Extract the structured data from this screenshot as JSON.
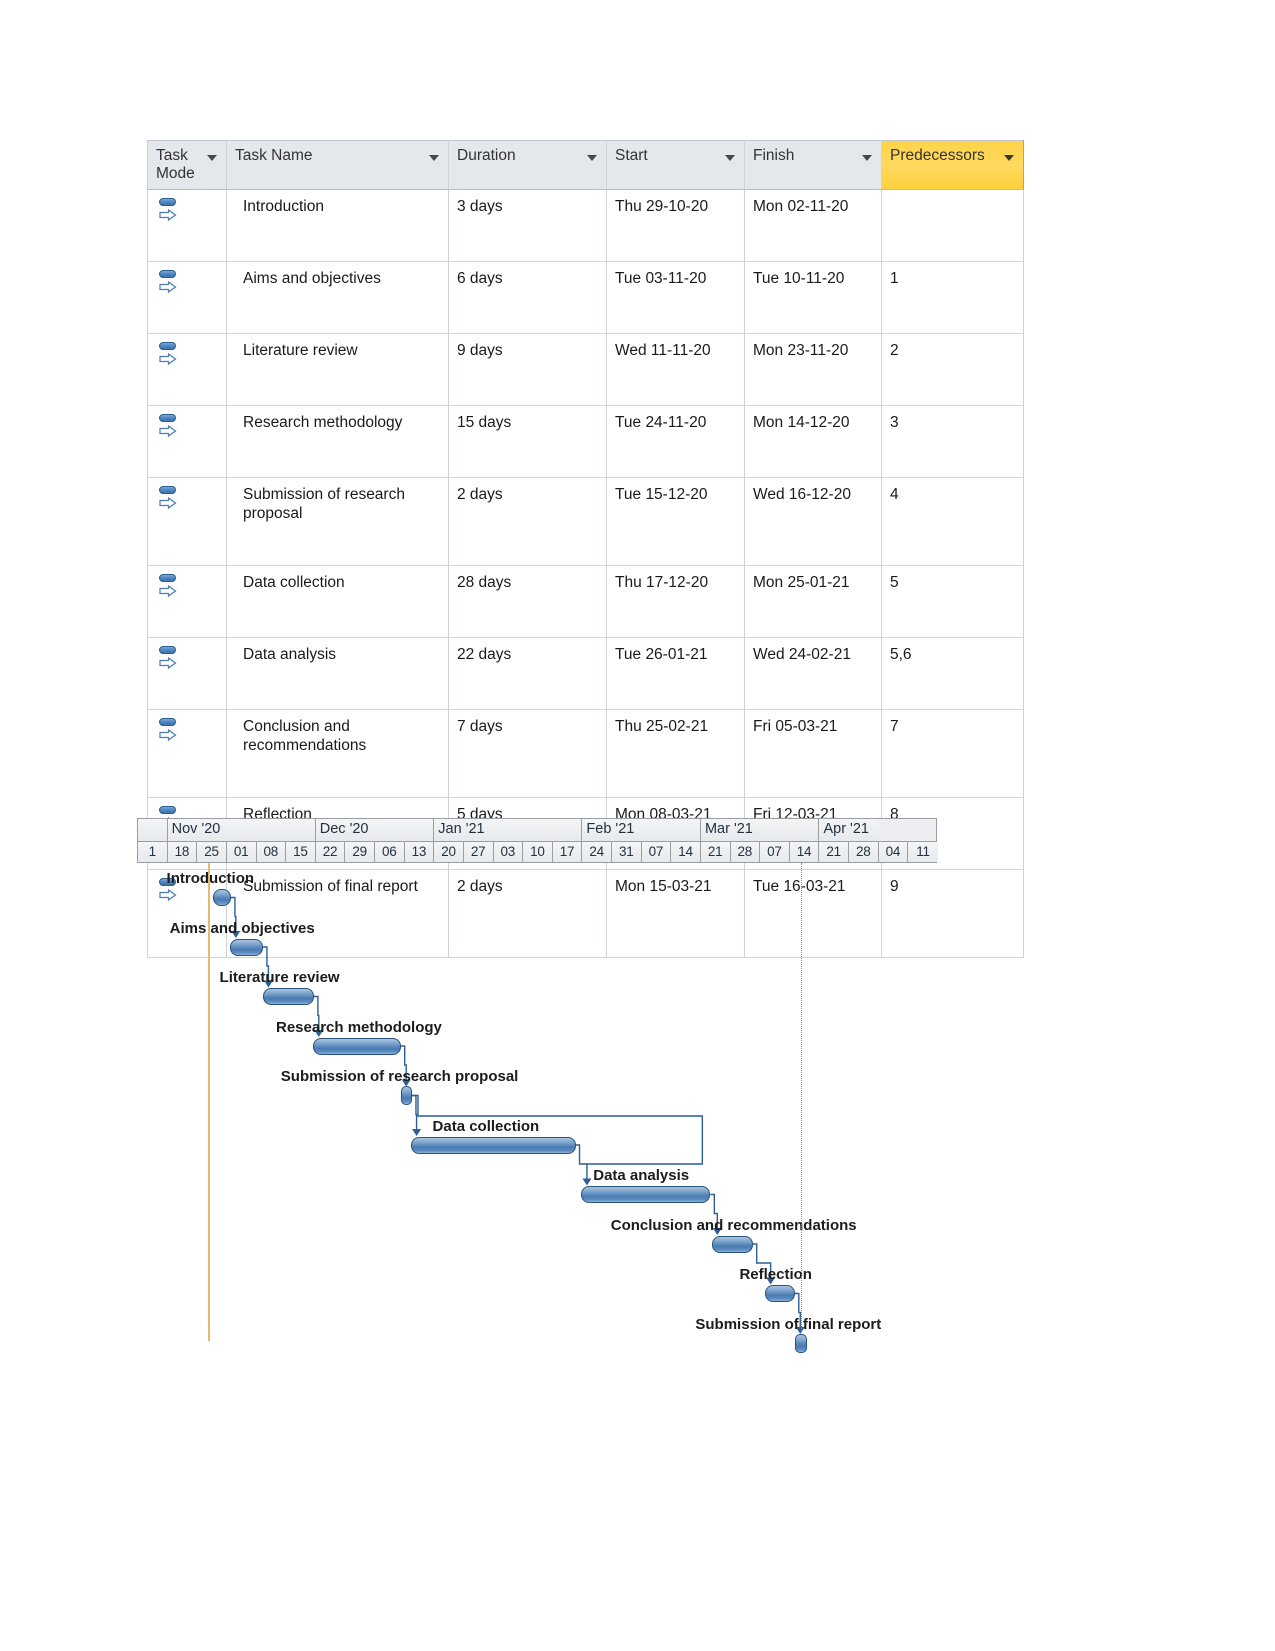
{
  "sheet": {
    "columns": [
      {
        "key": "task_mode",
        "label": "Task Mode",
        "highlight": false
      },
      {
        "key": "task_name",
        "label": "Task Name",
        "highlight": false
      },
      {
        "key": "duration",
        "label": "Duration",
        "highlight": false
      },
      {
        "key": "start",
        "label": "Start",
        "highlight": false
      },
      {
        "key": "finish",
        "label": "Finish",
        "highlight": false
      },
      {
        "key": "predecessors",
        "label": "Predecessors",
        "highlight": true
      }
    ],
    "filter_icon": "filter-dropdown-arrow-icon",
    "task_mode_icon": "auto-scheduled-task-icon",
    "rows": [
      {
        "task_name": "Introduction",
        "duration": "3 days",
        "start": "Thu 29-10-20",
        "finish": "Mon 02-11-20",
        "predecessors": ""
      },
      {
        "task_name": "Aims and objectives",
        "duration": "6 days",
        "start": "Tue 03-11-20",
        "finish": "Tue 10-11-20",
        "predecessors": "1"
      },
      {
        "task_name": "Literature review",
        "duration": "9 days",
        "start": "Wed 11-11-20",
        "finish": "Mon 23-11-20",
        "predecessors": "2"
      },
      {
        "task_name": "Research methodology",
        "duration": "15 days",
        "start": "Tue 24-11-20",
        "finish": "Mon 14-12-20",
        "predecessors": "3"
      },
      {
        "task_name": "Submission of research proposal",
        "duration": "2 days",
        "start": "Tue 15-12-20",
        "finish": "Wed 16-12-20",
        "predecessors": "4"
      },
      {
        "task_name": "Data collection",
        "duration": "28 days",
        "start": "Thu 17-12-20",
        "finish": "Mon 25-01-21",
        "predecessors": "5"
      },
      {
        "task_name": "Data analysis",
        "duration": "22 days",
        "start": "Tue 26-01-21",
        "finish": "Wed 24-02-21",
        "predecessors": "5,6"
      },
      {
        "task_name": "Conclusion and recommendations",
        "duration": "7 days",
        "start": "Thu 25-02-21",
        "finish": "Fri 05-03-21",
        "predecessors": "7"
      },
      {
        "task_name": "Reflection",
        "duration": "5 days",
        "start": "Mon 08-03-21",
        "finish": "Fri 12-03-21",
        "predecessors": "8"
      },
      {
        "task_name": "Submission of final report",
        "duration": "2 days",
        "start": "Mon 15-03-21",
        "finish": "Tue 16-03-21",
        "predecessors": "9"
      }
    ]
  },
  "chart_data": {
    "type": "bar",
    "title": "",
    "xlabel": "",
    "ylabel": "",
    "timescale": {
      "months": [
        {
          "label": "",
          "weeks": 1
        },
        {
          "label": "Nov '20",
          "weeks": 5
        },
        {
          "label": "Dec '20",
          "weeks": 4
        },
        {
          "label": "Jan '21",
          "weeks": 5
        },
        {
          "label": "Feb '21",
          "weeks": 4
        },
        {
          "label": "Mar '21",
          "weeks": 4
        },
        {
          "label": "Apr '21",
          "weeks": 2
        }
      ],
      "days": [
        "1",
        "18",
        "25",
        "01",
        "08",
        "15",
        "22",
        "29",
        "06",
        "13",
        "20",
        "27",
        "03",
        "10",
        "17",
        "24",
        "31",
        "07",
        "14",
        "21",
        "28",
        "07",
        "14",
        "21",
        "28",
        "04",
        "11"
      ],
      "leading_partial_label": "0"
    },
    "bars": [
      {
        "label": "Introduction",
        "start_week": 2.55,
        "span_weeks": 0.62,
        "milestone": false
      },
      {
        "label": "Aims and objectives",
        "start_week": 3.15,
        "span_weeks": 1.1,
        "milestone": false
      },
      {
        "label": "Literature review",
        "start_week": 4.25,
        "span_weeks": 1.72,
        "milestone": false
      },
      {
        "label": "Research methodology",
        "start_week": 5.95,
        "span_weeks": 2.95,
        "milestone": false
      },
      {
        "label": "Submission of research proposal",
        "start_week": 8.9,
        "span_weeks": 0.38,
        "milestone": true
      },
      {
        "label": "Data collection",
        "start_week": 9.25,
        "span_weeks": 5.55,
        "milestone": false
      },
      {
        "label": "Data analysis",
        "start_week": 15.0,
        "span_weeks": 4.35,
        "milestone": false
      },
      {
        "label": "Conclusion and recommendations",
        "start_week": 19.4,
        "span_weeks": 1.38,
        "milestone": false
      },
      {
        "label": "Reflection",
        "start_week": 21.2,
        "span_weeks": 1.0,
        "milestone": false
      },
      {
        "label": "Submission of final report",
        "start_week": 22.2,
        "span_weeks": 0.4,
        "milestone": true
      }
    ],
    "markers": {
      "project_start_line_color": "#e8b96b",
      "project_start_week": 2.4,
      "today_line_color": "#8c8c8c",
      "today_week": 22.4
    },
    "bar_color": "#4a7bb2",
    "link_color": "#2d5f96"
  }
}
